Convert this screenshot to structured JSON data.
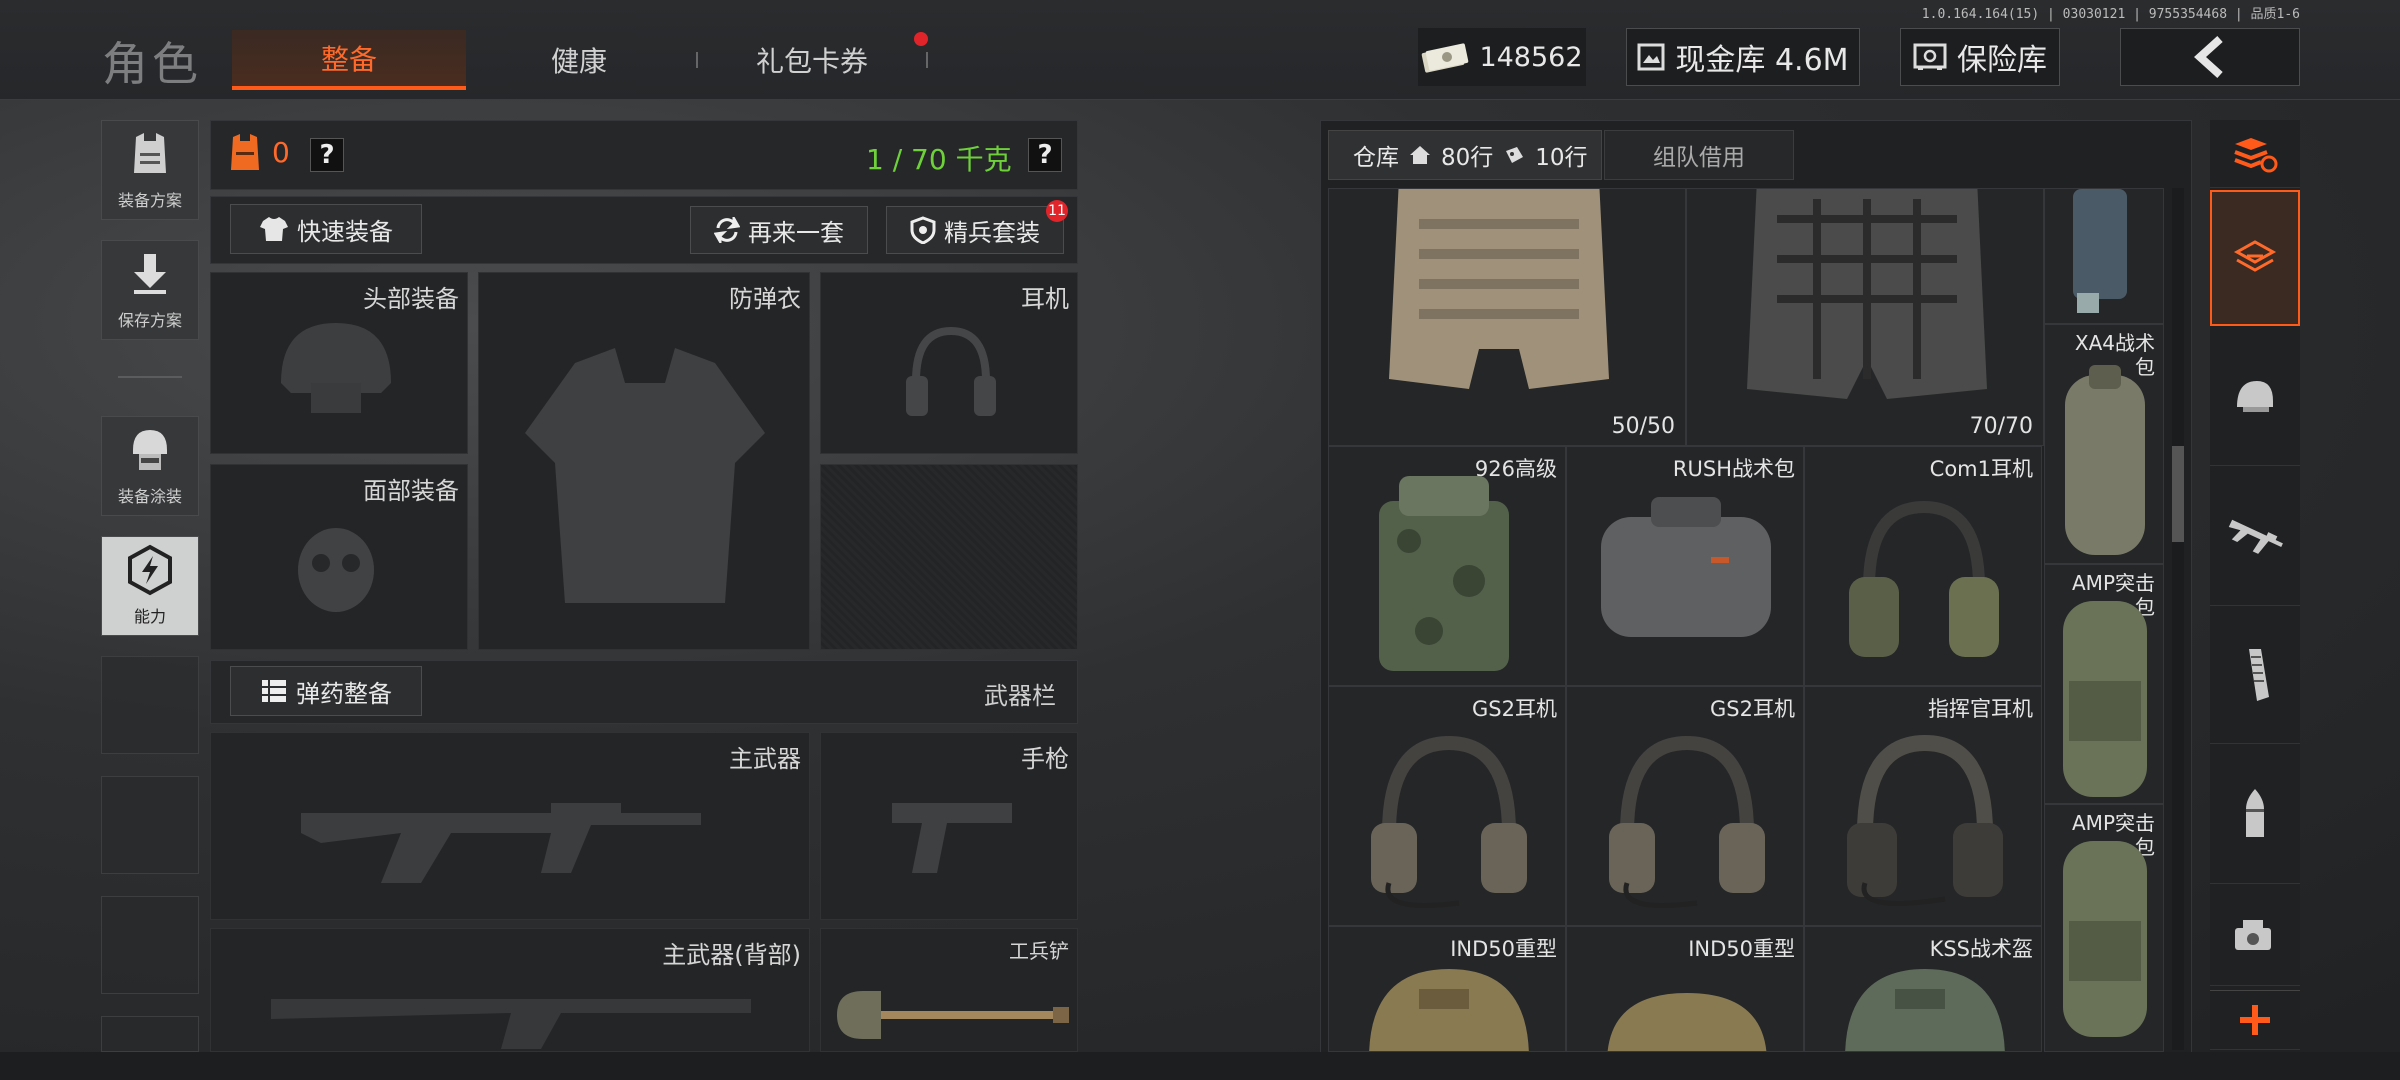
{
  "build_info": "1.0.164.164(15) | 03030121 | 9755354468 | 品质1-6",
  "header": {
    "title": "角色",
    "tabs": [
      {
        "label": "整备",
        "active": true
      },
      {
        "label": "健康",
        "active": false
      },
      {
        "label": "礼包卡券",
        "active": false,
        "badge_dot": true
      }
    ],
    "currency": "148562",
    "cash_vault": "现金库 4.6M",
    "safe_label": "保险库"
  },
  "left_menu": {
    "items": [
      {
        "label": "装备方案",
        "icon": "vest-icon"
      },
      {
        "label": "保存方案",
        "icon": "download-arrow-icon"
      },
      {
        "label": "装备涂装",
        "icon": "helmet-skin-icon"
      },
      {
        "label": "能力",
        "icon": "hex-lightning-icon",
        "active": true
      }
    ]
  },
  "loadout": {
    "armor_value": "0",
    "help": "?",
    "weight": "1 / 70 千克",
    "quick_equip": "快速装备",
    "redo_set": "再来一套",
    "elite_set": "精兵套装",
    "elite_badge": "11",
    "slots": {
      "head": "头部装备",
      "armor": "防弹衣",
      "ears": "耳机",
      "face": "面部装备"
    },
    "ammo_equip": "弹药整备",
    "weapon_bar": "武器栏",
    "primary": "主武器",
    "pistol": "手枪",
    "primary_back": "主武器(背部)",
    "shovel": "工兵铲"
  },
  "inventory": {
    "tab_warehouse": "仓库",
    "rows_total": "80行",
    "rows_extra": "10行",
    "tab_team": "组队借用",
    "counts": [
      "50/50",
      "70/70"
    ],
    "items": [
      {
        "name": "926高级"
      },
      {
        "name": "RUSH战术包"
      },
      {
        "name": "Com1耳机"
      },
      {
        "name": "GS2耳机"
      },
      {
        "name": "GS2耳机"
      },
      {
        "name": "指挥官耳机"
      },
      {
        "name": "IND50重型"
      },
      {
        "name": "IND50重型"
      },
      {
        "name": "KSS战术盔"
      }
    ],
    "side_items": [
      {
        "name": "XA4战术包"
      },
      {
        "name": "AMP突击包"
      },
      {
        "name": "AMP突击包"
      }
    ]
  },
  "right_sidebar": {
    "icons": [
      "stack-refresh-icon",
      "layers-icon",
      "helmet-icon",
      "rifle-icon",
      "magazine-icon",
      "bullet-icon",
      "scope-icon",
      "plus-icon"
    ]
  },
  "colors": {
    "accent": "#ff5a1a",
    "weight_green": "#6fd13a",
    "badge_red": "#e0242a"
  }
}
